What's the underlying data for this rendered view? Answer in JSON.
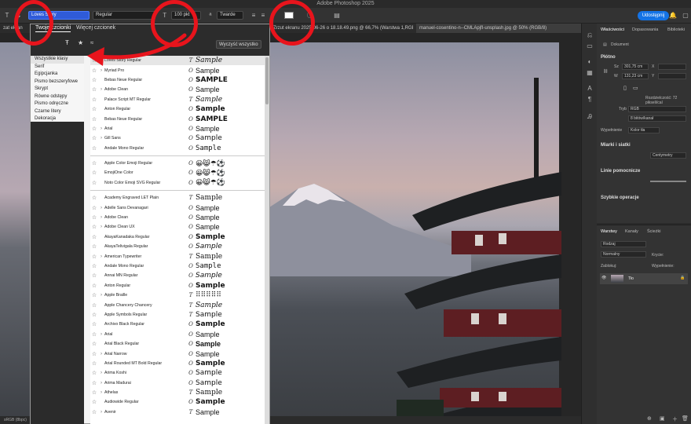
{
  "app": {
    "title": "Adobe Photoshop 2025"
  },
  "options_bar": {
    "font_family": "Loves Story",
    "font_style": "Regular",
    "font_size": "100 pkt",
    "antialias": "Twarde",
    "share_label": "Udostępnij"
  },
  "tabs": [
    {
      "label": "zat ekran"
    },
    {
      "label": "Zrzut ekranu 2025-06-26 o 18.18.49.png @ 66,7% (Warstwa 1,RGB/8)"
    },
    {
      "label": "manuel-cosentino-n--CMLApjfI-unsplash.jpg @ 50% (RGB/8)"
    }
  ],
  "status": {
    "text": "sRGB (8bpc)"
  },
  "font_panel": {
    "tab_your_fonts": "Twoje czcionki",
    "tab_more_fonts": "Więcej czcionek",
    "clear_all": "Wyczyść wszystko",
    "categories": [
      "Wszystkie klasy",
      "Serif",
      "Egipcjanka",
      "Pismo bezszeryfowe",
      "Skrypt",
      "Równe odstępy",
      "Pismo odręczne",
      "Czarne litery",
      "Dekoracja"
    ],
    "fonts_group1": [
      {
        "name": "Loves Story Regular",
        "type": "T",
        "sample": "Sample",
        "chev": "",
        "font": "\"DejaVu Serif\", serif",
        "style": "italic"
      },
      {
        "name": "Myriad Pro",
        "type": "O",
        "sample": "Sample",
        "chev": "›",
        "font": "\"Liberation Sans\", sans-serif",
        "style": "normal"
      },
      {
        "name": "Bebas Neue Regular",
        "type": "O",
        "sample": "SAMPLE",
        "chev": "",
        "font": "\"DejaVu Sans\", sans-serif",
        "style": "bold"
      },
      {
        "name": "Adobe Clean",
        "type": "O",
        "sample": "Sample",
        "chev": "›",
        "font": "\"Liberation Sans\", sans-serif",
        "style": "normal"
      },
      {
        "name": "Palace Script MT Regular",
        "type": "T",
        "sample": "Sample",
        "chev": "",
        "font": "\"DejaVu Serif\", serif",
        "style": "italic"
      },
      {
        "name": "Anton Regular",
        "type": "O",
        "sample": "Sample",
        "chev": "",
        "font": "\"DejaVu Sans\", sans-serif",
        "style": "bold"
      },
      {
        "name": "Bebas Neue Regular",
        "type": "O",
        "sample": "SAMPLE",
        "chev": "",
        "font": "\"DejaVu Sans\", sans-serif",
        "style": "bold"
      },
      {
        "name": "Arial",
        "type": "O",
        "sample": "Sample",
        "chev": "›",
        "font": "\"Liberation Sans\", sans-serif",
        "style": "normal"
      },
      {
        "name": "Gill Sans",
        "type": "O",
        "sample": "Sample",
        "chev": "›",
        "font": "\"DejaVu Sans\", sans-serif",
        "style": "normal"
      },
      {
        "name": "Andale Mono Regular",
        "type": "O",
        "sample": "Sample",
        "chev": "",
        "font": "\"DejaVu Sans Mono\", monospace",
        "style": "normal"
      }
    ],
    "fonts_group2": [
      {
        "name": "Apple Color Emoji Regular",
        "type": "O",
        "sample": "😀😸☂⚽",
        "chev": ""
      },
      {
        "name": "EmojiOne Color",
        "type": "O",
        "sample": "😀😸☂⚽",
        "chev": ""
      },
      {
        "name": "Noto Color Emoji SVG Regular",
        "type": "O",
        "sample": "😀😸☂⚽",
        "chev": ""
      }
    ],
    "fonts_group3": [
      {
        "name": "Academy Engraved LET Plain",
        "type": "T",
        "sample": "Sample",
        "chev": "",
        "font": "\"DejaVu Serif\", serif",
        "style": "normal"
      },
      {
        "name": "Adelle Sans Devanagari",
        "type": "O",
        "sample": "Sample",
        "chev": "›",
        "font": "\"Liberation Sans\", sans-serif",
        "style": "normal"
      },
      {
        "name": "Adobe Clean",
        "type": "O",
        "sample": "Sample",
        "chev": "›",
        "font": "\"Liberation Sans\", sans-serif",
        "style": "normal"
      },
      {
        "name": "Adobe Clean UX",
        "type": "O",
        "sample": "Sample",
        "chev": "›",
        "font": "\"Liberation Sans\", sans-serif",
        "style": "normal"
      },
      {
        "name": "AkayaKanadaka Regular",
        "type": "O",
        "sample": "Sample",
        "chev": "",
        "font": "\"DejaVu Sans\", sans-serif",
        "style": "bold"
      },
      {
        "name": "AkayaTelivigala Regular",
        "type": "O",
        "sample": "Sample",
        "chev": "",
        "font": "\"DejaVu Sans\", sans-serif",
        "style": "italic"
      },
      {
        "name": "American Typewriter",
        "type": "T",
        "sample": "Sample",
        "chev": "›",
        "font": "\"DejaVu Serif\", serif",
        "style": "normal"
      },
      {
        "name": "Andale Mono Regular",
        "type": "O",
        "sample": "Sample",
        "chev": "",
        "font": "\"DejaVu Sans Mono\", monospace",
        "style": "normal"
      },
      {
        "name": "Annai MN Regular",
        "type": "O",
        "sample": "Sample",
        "chev": "",
        "font": "\"DejaVu Sans\", sans-serif",
        "style": "italic"
      },
      {
        "name": "Anton Regular",
        "type": "O",
        "sample": "Sample",
        "chev": "",
        "font": "\"DejaVu Sans\", sans-serif",
        "style": "bold"
      },
      {
        "name": "Apple Braille",
        "type": "T",
        "sample": "⠿⠿⠿⠿⠿",
        "chev": "›",
        "font": "\"DejaVu Sans\", sans-serif",
        "style": "normal"
      },
      {
        "name": "Apple Chancery Chancery",
        "type": "T",
        "sample": "Sample",
        "chev": "",
        "font": "\"DejaVu Serif\", serif",
        "style": "italic"
      },
      {
        "name": "Apple Symbols Regular",
        "type": "T",
        "sample": "Sample",
        "chev": "",
        "font": "\"DejaVu Sans\", sans-serif",
        "style": "normal"
      },
      {
        "name": "Archivo Black Regular",
        "type": "O",
        "sample": "Sample",
        "chev": "",
        "font": "\"DejaVu Sans\", sans-serif",
        "style": "bold"
      },
      {
        "name": "Arial",
        "type": "O",
        "sample": "Sample",
        "chev": "›",
        "font": "\"Liberation Sans\", sans-serif",
        "style": "normal"
      },
      {
        "name": "Arial Black Regular",
        "type": "O",
        "sample": "Sample",
        "chev": "",
        "font": "\"Liberation Sans\", sans-serif",
        "style": "bold"
      },
      {
        "name": "Arial Narrow",
        "type": "O",
        "sample": "Sample",
        "chev": "›",
        "font": "\"Liberation Sans\", sans-serif",
        "style": "normal"
      },
      {
        "name": "Arial Rounded MT Bold Regular",
        "type": "O",
        "sample": "Sample",
        "chev": "",
        "font": "\"DejaVu Sans\", sans-serif",
        "style": "bold"
      },
      {
        "name": "Arima Koshi",
        "type": "O",
        "sample": "Sample",
        "chev": "›",
        "font": "\"DejaVu Sans\", sans-serif",
        "style": "normal"
      },
      {
        "name": "Arima Madurai",
        "type": "O",
        "sample": "Sample",
        "chev": "›",
        "font": "\"DejaVu Sans\", sans-serif",
        "style": "normal"
      },
      {
        "name": "Athelas",
        "type": "T",
        "sample": "Sample",
        "chev": "›",
        "font": "\"DejaVu Serif\", serif",
        "style": "normal"
      },
      {
        "name": "Audiowide Regular",
        "type": "O",
        "sample": "Sample",
        "chev": "",
        "font": "\"DejaVu Sans\", sans-serif",
        "style": "bold"
      },
      {
        "name": "Avenir",
        "type": "T",
        "sample": "Sample",
        "chev": "›",
        "font": "\"Liberation Sans\", sans-serif",
        "style": "normal"
      }
    ]
  },
  "properties": {
    "tabs": [
      "Właściwości",
      "Dopasowania",
      "Biblioteki"
    ],
    "doc_label": "Dokument",
    "canvas_title": "Płótno",
    "width_label": "Sz",
    "width_value": "301,75 cm",
    "height_label": "W",
    "height_value": "131,23 cm",
    "x_label": "X",
    "y_label": "Y",
    "resolution": "Rozdzielczość: 72 pikseli/cal",
    "mode_label": "Tryb",
    "mode_value": "RGB",
    "bits_value": "8 bitów/kanał",
    "fill_label": "Wypełnienie",
    "fill_value": "Kolor tła",
    "rulers_title": "Miarki i siatki",
    "rulers_unit": "Centymetry",
    "guides_title": "Linie pomocnicze",
    "quick_title": "Szybkie operacje"
  },
  "layers": {
    "tabs": [
      "Warstwy",
      "Kanały",
      "Ścieżki"
    ],
    "search": "Rodzaj",
    "blend": "Normalny",
    "opacity_label": "Krycie:",
    "lock_label": "Zablokuj:",
    "fill_label": "Wypełnienie:",
    "layer_name": "Tło"
  }
}
